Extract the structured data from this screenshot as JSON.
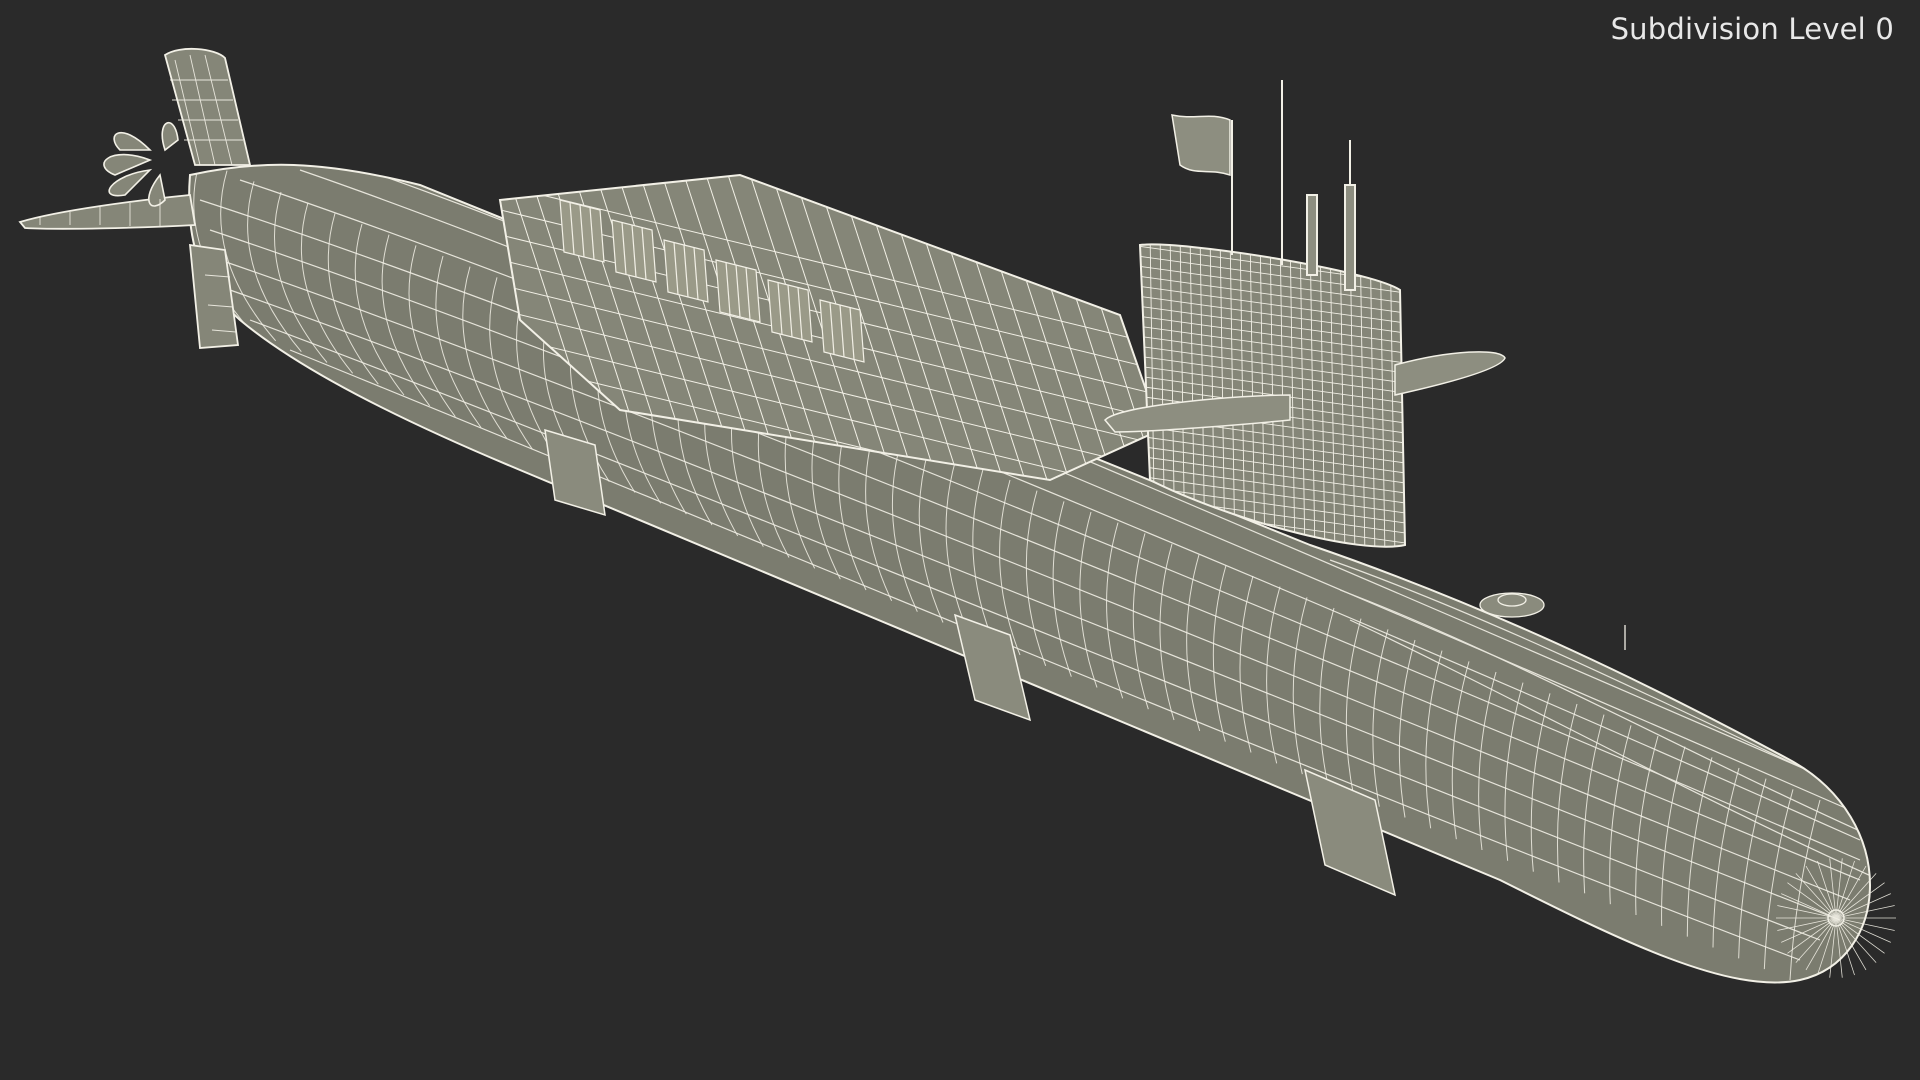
{
  "viewport": {
    "overlay_label": "Subdivision Level 0",
    "background_color": "#2a2a2a",
    "model_color": "#7b7c6f",
    "wire_color": "#f2f0e6"
  }
}
